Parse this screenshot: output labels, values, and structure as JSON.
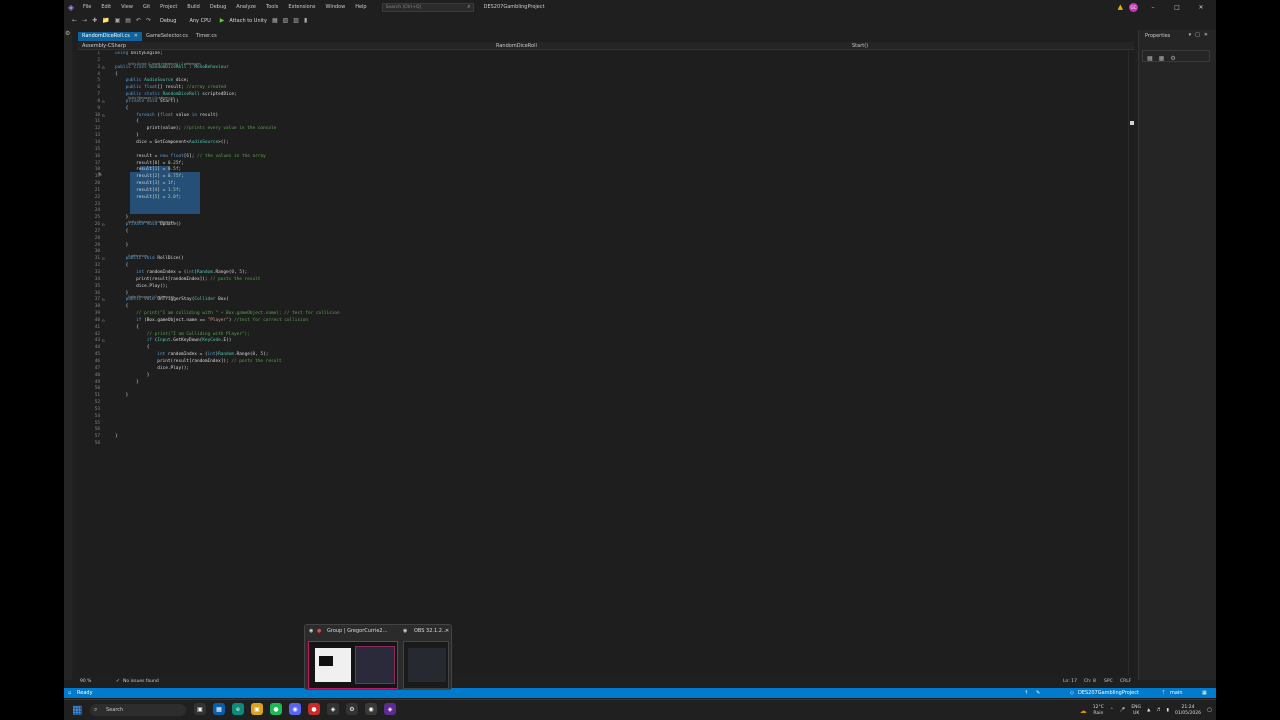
{
  "menu": {
    "items": [
      "File",
      "Edit",
      "View",
      "Git",
      "Project",
      "Build",
      "Debug",
      "Analyze",
      "Tools",
      "Extensions",
      "Window",
      "Help"
    ],
    "search_placeholder": "Search (Ctrl+Q)",
    "project_name": "DES207GamblingProject",
    "avatar_initials": "GC"
  },
  "toolbar": {
    "config": "Debug",
    "platform": "Any CPU",
    "attach": "Attach to Unity"
  },
  "tabs": [
    {
      "label": "RandomDiceRoll.cs",
      "active": true
    },
    {
      "label": "GameSelector.cs",
      "active": false
    },
    {
      "label": "Timer.cs",
      "active": false
    }
  ],
  "navbar": {
    "project": "Assembly-CSharp",
    "class": "RandomDiceRoll",
    "method": "Start()"
  },
  "code_lines": [
    {
      "n": "1",
      "t": "using UnityEngine;"
    },
    {
      "n": "2",
      "t": ""
    },
    {
      "n": "3",
      "t": "public class RandomDiceRoll : MonoBehaviour",
      "lens": "Unity Script (1 asset reference) | 2 references"
    },
    {
      "n": "4",
      "t": "{"
    },
    {
      "n": "5",
      "t": "    public AudioSource dice;"
    },
    {
      "n": "6",
      "t": "    public float[] result; //array created"
    },
    {
      "n": "7",
      "t": "    public static RandomDiceRoll scriptedDice;"
    },
    {
      "n": "8",
      "t": "    private void Start()",
      "lens": "Unity Message | 0 references"
    },
    {
      "n": "9",
      "t": "    {"
    },
    {
      "n": "10",
      "t": "        foreach (float value in result)"
    },
    {
      "n": "11",
      "t": "        {"
    },
    {
      "n": "12",
      "t": "            print(value); //prints every value in the console"
    },
    {
      "n": "13",
      "t": "        }"
    },
    {
      "n": "14",
      "t": "        dice = GetComponent<AudioSource>();"
    },
    {
      "n": "15",
      "t": ""
    },
    {
      "n": "16",
      "t": "        result = new float[6]; // the values in the array"
    },
    {
      "n": "17",
      "t": "        result[0] = 0.25f;"
    },
    {
      "n": "18",
      "t": "        result[1] = 0.5f;"
    },
    {
      "n": "19",
      "t": "        result[2] = 0.75f;"
    },
    {
      "n": "20",
      "t": "        result[3] = 1f;"
    },
    {
      "n": "21",
      "t": "        result[4] = 1.5f;"
    },
    {
      "n": "22",
      "t": "        result[5] = 2.0f;"
    },
    {
      "n": "23",
      "t": ""
    },
    {
      "n": "24",
      "t": ""
    },
    {
      "n": "25",
      "t": "    }"
    },
    {
      "n": "26",
      "t": "    private void Update()",
      "lens": "Unity Message | 0 references"
    },
    {
      "n": "27",
      "t": "    {"
    },
    {
      "n": "28",
      "t": ""
    },
    {
      "n": "29",
      "t": "    }"
    },
    {
      "n": "30",
      "t": ""
    },
    {
      "n": "31",
      "t": "    public void RollDice()",
      "lens": "0 references"
    },
    {
      "n": "32",
      "t": "    {"
    },
    {
      "n": "33",
      "t": "        int randomIndex = (int)Random.Range(0, 5);"
    },
    {
      "n": "34",
      "t": "        print(result[randomIndex]); // posts the result"
    },
    {
      "n": "35",
      "t": "        dice.Play();"
    },
    {
      "n": "36",
      "t": "    }"
    },
    {
      "n": "37",
      "t": "    public void OnTriggerStay(Collider Box)",
      "lens": "Unity Message | 0 references"
    },
    {
      "n": "38",
      "t": "    {"
    },
    {
      "n": "39",
      "t": "        // print(\"I am colliding with \" + Box.gameObject.name); // test for collision"
    },
    {
      "n": "40",
      "t": "        if (Box.gameObject.name == \"Player\") //test for correct collision"
    },
    {
      "n": "41",
      "t": "        {"
    },
    {
      "n": "42",
      "t": "            // print(\"I am Colliding with Player\");"
    },
    {
      "n": "43",
      "t": "            if (Input.GetKeyDown(KeyCode.E))"
    },
    {
      "n": "44",
      "t": "            {"
    },
    {
      "n": "45",
      "t": "                int randomIndex = (int)Random.Range(0, 5);"
    },
    {
      "n": "46",
      "t": "                print(result[randomIndex]); // posts the result"
    },
    {
      "n": "47",
      "t": "                dice.Play();"
    },
    {
      "n": "48",
      "t": "            }"
    },
    {
      "n": "49",
      "t": "        }"
    },
    {
      "n": "50",
      "t": ""
    },
    {
      "n": "51",
      "t": "    }"
    },
    {
      "n": "52",
      "t": ""
    },
    {
      "n": "53",
      "t": ""
    },
    {
      "n": "54",
      "t": ""
    },
    {
      "n": "55",
      "t": ""
    },
    {
      "n": "56",
      "t": ""
    },
    {
      "n": "57",
      "t": "}"
    },
    {
      "n": "58",
      "t": ""
    }
  ],
  "properties": {
    "title": "Properties"
  },
  "editor_status": {
    "zoom": "90 %",
    "issues": "No issues found",
    "line": "Ln: 17",
    "col": "Ch: 8",
    "spc": "SPC",
    "eol": "CRLF"
  },
  "statusbar": {
    "ready": "Ready",
    "project": "DES207GamblingProject",
    "branch": "main"
  },
  "taskbar": {
    "search": "Search",
    "weather_temp": "12°C",
    "weather_desc": "Rain",
    "lang": "ENG",
    "region": "UK",
    "time": "21:24",
    "date": "01/05/2026"
  },
  "preview": {
    "group_label": "Group | GregorCurrie2...",
    "obs_label": "OBS 32.1.2..."
  },
  "colors": {
    "accent": "#007acc",
    "tab_active": "#0e639c",
    "selection": "#264f78",
    "keyword": "#569cd6",
    "type": "#4ec9b0",
    "comment": "#57a64a",
    "string": "#d69d85",
    "number": "#b5cea8"
  }
}
